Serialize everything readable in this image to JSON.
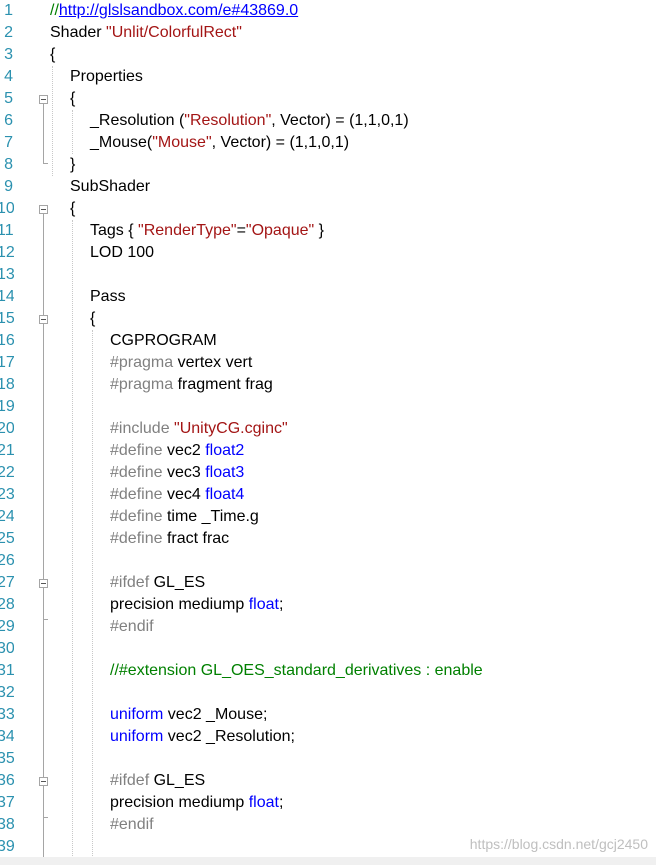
{
  "line_numbers": [
    "1",
    "2",
    "3",
    "4",
    "5",
    "6",
    "7",
    "8",
    "9",
    "10",
    "11",
    "12",
    "13",
    "14",
    "15",
    "16",
    "17",
    "18",
    "19",
    "20",
    "21",
    "22",
    "23",
    "24",
    "25",
    "26",
    "27",
    "28",
    "29",
    "30",
    "31",
    "32",
    "33",
    "34",
    "35",
    "36",
    "37",
    "38",
    "39"
  ],
  "colors": {
    "line_number": "#2b91af",
    "string": "#a31515",
    "keyword": "#0000ff",
    "preprocessor": "#808080",
    "comment": "#008000",
    "link": "#0000ff"
  },
  "code": {
    "l1_comment": "//",
    "l1_link": "http://glslsandbox.com/e#43869.0",
    "l2_a": "Shader ",
    "l2_b": "\"Unlit/ColorfulRect\"",
    "l3": "{",
    "l4": "Properties",
    "l5": "{",
    "l6_a": "_Resolution (",
    "l6_b": "\"Resolution\"",
    "l6_c": ", Vector) = (1,1,0,1)",
    "l7_a": "_Mouse(",
    "l7_b": "\"Mouse\"",
    "l7_c": ", Vector) = (1,1,0,1)",
    "l8": "}",
    "l9": "SubShader",
    "l10": "{",
    "l11_a": "Tags { ",
    "l11_b": "\"RenderType\"",
    "l11_c": "=",
    "l11_d": "\"Opaque\"",
    "l11_e": " }",
    "l12": "LOD 100",
    "l14": "Pass",
    "l15": "{",
    "l16": "CGPROGRAM",
    "l17_a": "#pragma",
    "l17_b": " vertex vert",
    "l18_a": "#pragma",
    "l18_b": " fragment frag",
    "l20_a": "#include ",
    "l20_b": "\"UnityCG.cginc\"",
    "l21_a": "#define",
    "l21_b": " vec2 ",
    "l21_c": "float2",
    "l22_a": "#define",
    "l22_b": " vec3 ",
    "l22_c": "float3",
    "l23_a": "#define",
    "l23_b": " vec4 ",
    "l23_c": "float4",
    "l24_a": "#define",
    "l24_b": " time _Time.g",
    "l25_a": "#define",
    "l25_b": " fract frac",
    "l27_a": "#ifdef",
    "l27_b": " GL_ES",
    "l28_a": "precision mediump ",
    "l28_b": "float",
    "l28_c": ";",
    "l29": "#endif",
    "l31": "//#extension GL_OES_standard_derivatives : enable",
    "l33_a": "uniform",
    "l33_b": " vec2 _Mouse;",
    "l34_a": "uniform",
    "l34_b": " vec2 _Resolution;",
    "l36_a": "#ifdef",
    "l36_b": " GL_ES",
    "l37_a": "precision mediump ",
    "l37_b": "float",
    "l37_c": ";",
    "l38": "#endif"
  },
  "watermark": "https://blog.csdn.net/gcj2450"
}
